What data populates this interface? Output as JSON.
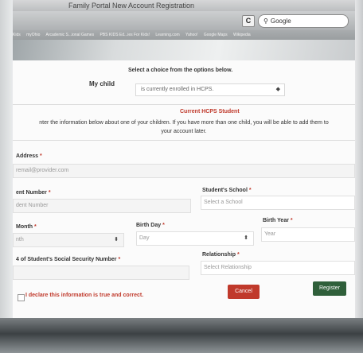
{
  "browser": {
    "window_title": "Family Portal New Account Registration",
    "reload_label": "C",
    "search_placeholder": "Google",
    "bookmarks": [
      "Kids",
      "myOhio",
      "Arcademic S...ional Games",
      "PBS KIDS Ed...ies For Kids!",
      "Learning.com",
      "Yahoo!",
      "Google Maps",
      "Wikipedia"
    ]
  },
  "form": {
    "prompt": "Select a choice from the options below.",
    "my_child_label": "My child",
    "enrollment_value": "is currently enrolled in HCPS.",
    "section_title": "Current HCPS Student",
    "instructions_line1": "nter the information below about one of your children. If you have more than one child, you will be able to add them to",
    "instructions_line2": "your account later.",
    "email_label": "Address",
    "email_placeholder": "remail@provider.com",
    "student_number_label": "ent Number",
    "student_number_placeholder": "dent Number",
    "school_label": "Student's School",
    "school_value": "Select a School",
    "birth_month_label": "Month",
    "birth_month_value": "nth",
    "birth_day_label": "Birth Day",
    "birth_day_value": "Day",
    "birth_year_label": "Birth Year",
    "birth_year_value": "Year",
    "ssn_label": "4 of Student's Social Security Number",
    "relationship_label": "Relationship",
    "relationship_value": "Select Relationship",
    "cancel_label": "Cancel",
    "register_label": "Register",
    "declare_label": "I declare this information is true and correct.",
    "required_mark": "*"
  },
  "colors": {
    "accent_red": "#c0392b",
    "register_green": "#2f5f3a"
  }
}
